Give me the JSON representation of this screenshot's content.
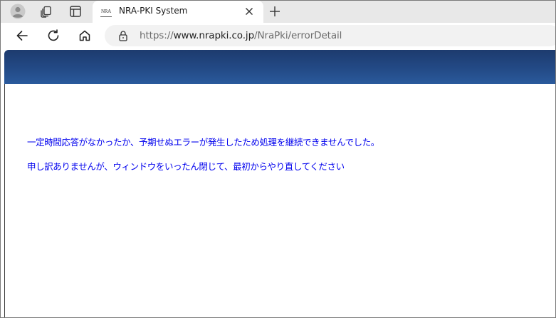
{
  "browser": {
    "tab": {
      "favicon_text": "NRA",
      "title": "NRA-PKI System"
    },
    "address": {
      "scheme": "https://",
      "host": "www.nrapki.co.jp",
      "path": "/NraPki/errorDetail"
    },
    "icons": {
      "profile": "profile-avatar-icon",
      "workspaces": "workspaces-icon",
      "tab_actions": "tab-actions-icon",
      "close": "close-icon",
      "new_tab": "plus-icon",
      "back": "back-arrow-icon",
      "refresh": "refresh-icon",
      "home": "home-icon",
      "lock": "lock-icon"
    }
  },
  "page": {
    "banner_color": "#234a86",
    "message_color": "#0000ee",
    "messages": [
      "一定時間応答がなかったか、予期せぬエラーが発生したため処理を継続できませんでした。",
      "申し訳ありませんが、ウィンドウをいったん閉じて、最初からやり直してください"
    ]
  }
}
